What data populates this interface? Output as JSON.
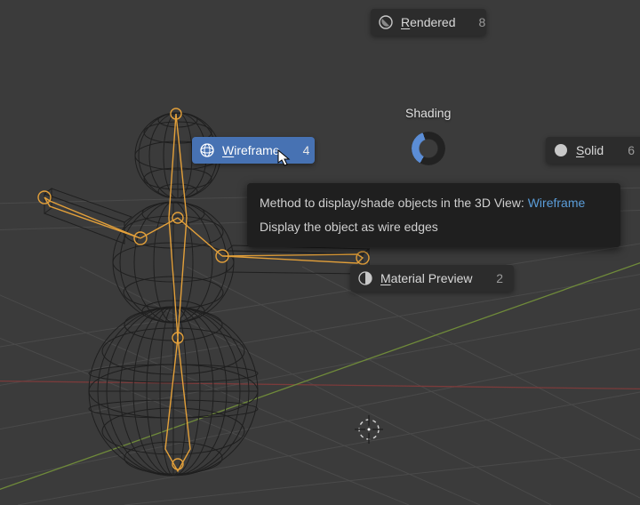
{
  "heading": "Shading",
  "modes": {
    "rendered": {
      "label_pre": "",
      "key": "R",
      "label_post": "endered",
      "hint": "8"
    },
    "wireframe": {
      "label_pre": "",
      "key": "W",
      "label_post": "ireframe",
      "hint": "4"
    },
    "solid": {
      "label_pre": "",
      "key": "S",
      "label_post": "olid",
      "hint": "6"
    },
    "material": {
      "label_pre": "",
      "key": "M",
      "label_post": "aterial Preview",
      "hint": "2"
    }
  },
  "tooltip": {
    "line1_pre": "Method to display/shade objects in the 3D View:  ",
    "line1_link": "Wireframe",
    "line2": "Display the object as wire edges"
  },
  "colors": {
    "accent": "#4772b3",
    "link": "#5b9dd9"
  }
}
